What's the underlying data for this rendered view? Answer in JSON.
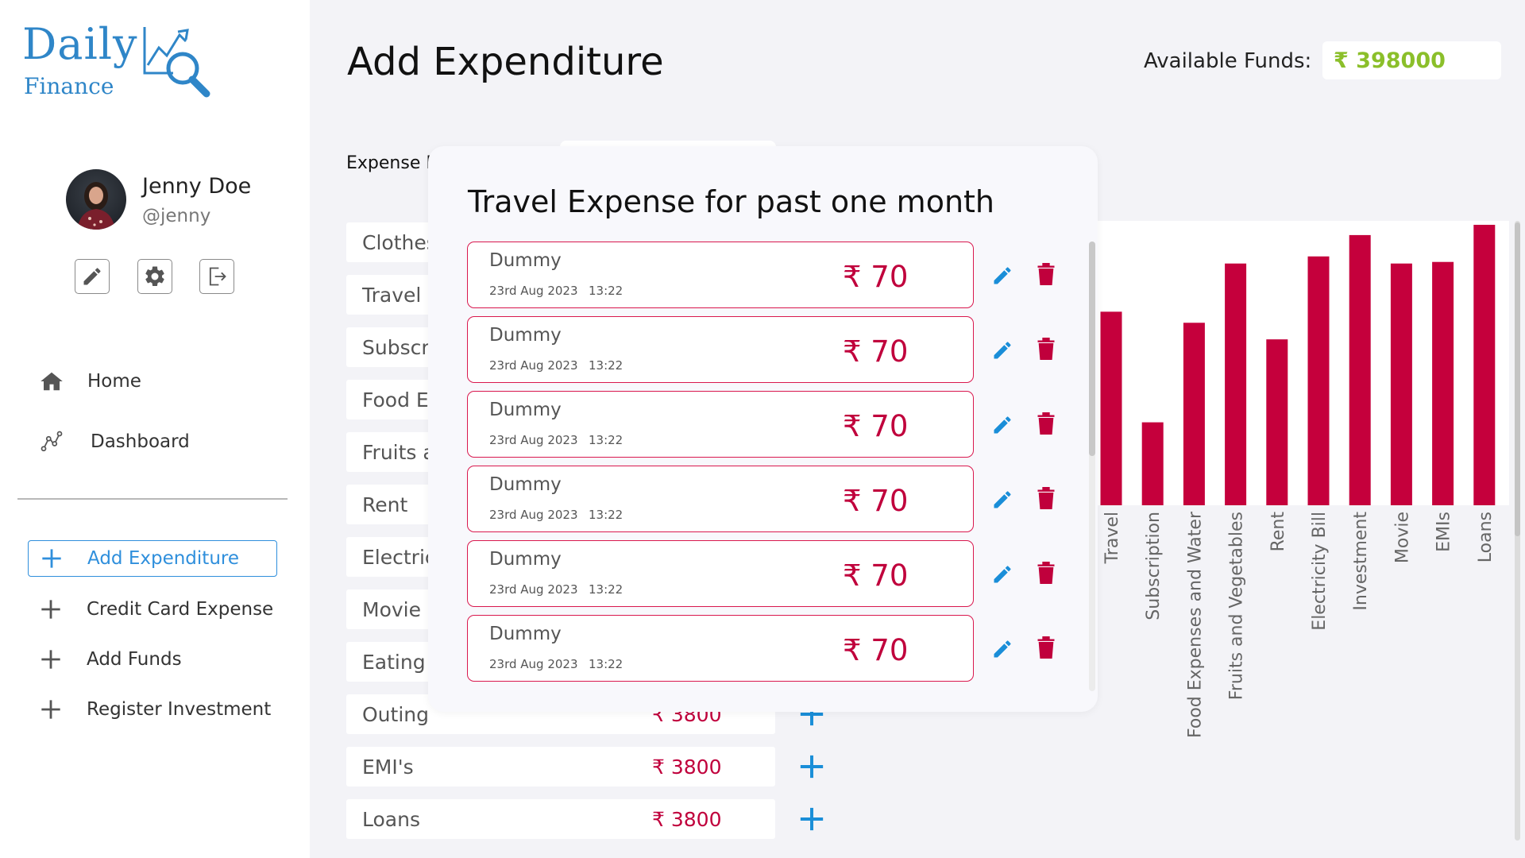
{
  "app": {
    "logo_line1": "Daily",
    "logo_line2": "Finance"
  },
  "user": {
    "name": "Jenny Doe",
    "handle": "@jenny"
  },
  "nav": [
    {
      "label": "Home",
      "icon": "home-icon"
    },
    {
      "label": "Dashboard",
      "icon": "graph-nodes-icon"
    }
  ],
  "actions": [
    {
      "label": "Add Expenditure",
      "active": true
    },
    {
      "label": "Credit Card Expense",
      "active": false
    },
    {
      "label": "Add Funds",
      "active": false
    },
    {
      "label": "Register Investment",
      "active": false
    }
  ],
  "header": {
    "title": "Add Expenditure",
    "funds_label": "Available Funds:",
    "funds_value": "₹ 398000"
  },
  "expense_section": {
    "heading": "Expense D"
  },
  "categories": [
    {
      "name": "Clothes",
      "amount": ""
    },
    {
      "name": "Travel",
      "amount": ""
    },
    {
      "name": "Subscri",
      "amount": ""
    },
    {
      "name": "Food E:",
      "amount": ""
    },
    {
      "name": "Fruits a",
      "amount": ""
    },
    {
      "name": "Rent",
      "amount": ""
    },
    {
      "name": "Electric",
      "amount": ""
    },
    {
      "name": "Movie",
      "amount": ""
    },
    {
      "name": "Eating",
      "amount": ""
    },
    {
      "name": "Outing",
      "amount": "₹ 3800"
    },
    {
      "name": "EMI's",
      "amount": "₹ 3800"
    },
    {
      "name": "Loans",
      "amount": "₹ 3800"
    }
  ],
  "modal": {
    "title": "Travel Expense for past one month",
    "items": [
      {
        "name": "Dummy",
        "date": "23rd Aug 2023",
        "time": "13:22",
        "amount": "₹ 70"
      },
      {
        "name": "Dummy",
        "date": "23rd Aug 2023",
        "time": "13:22",
        "amount": "₹ 70"
      },
      {
        "name": "Dummy",
        "date": "23rd Aug 2023",
        "time": "13:22",
        "amount": "₹ 70"
      },
      {
        "name": "Dummy",
        "date": "23rd Aug 2023",
        "time": "13:22",
        "amount": "₹ 70"
      },
      {
        "name": "Dummy",
        "date": "23rd Aug 2023",
        "time": "13:22",
        "amount": "₹ 70"
      },
      {
        "name": "Dummy",
        "date": "23rd Aug 2023",
        "time": "13:22",
        "amount": "₹ 70"
      }
    ]
  },
  "colors": {
    "accent_blue": "#2f8fdc",
    "expense_red": "#c0003c",
    "funds_green": "#8bbf2a",
    "bar_color": "#c5003c"
  },
  "chart_data": {
    "type": "bar",
    "categories": [
      "Travel",
      "Subscription",
      "Food Expenses and Water",
      "Fruits and Vegetables",
      "Rent",
      "Electricity Bill",
      "Investment",
      "Movie",
      "EMIs",
      "Loans"
    ],
    "values": [
      245,
      105,
      231,
      306,
      210,
      315,
      342,
      306,
      308,
      355
    ],
    "ylim": [
      0,
      360
    ],
    "title": "",
    "xlabel": "",
    "ylabel": ""
  }
}
